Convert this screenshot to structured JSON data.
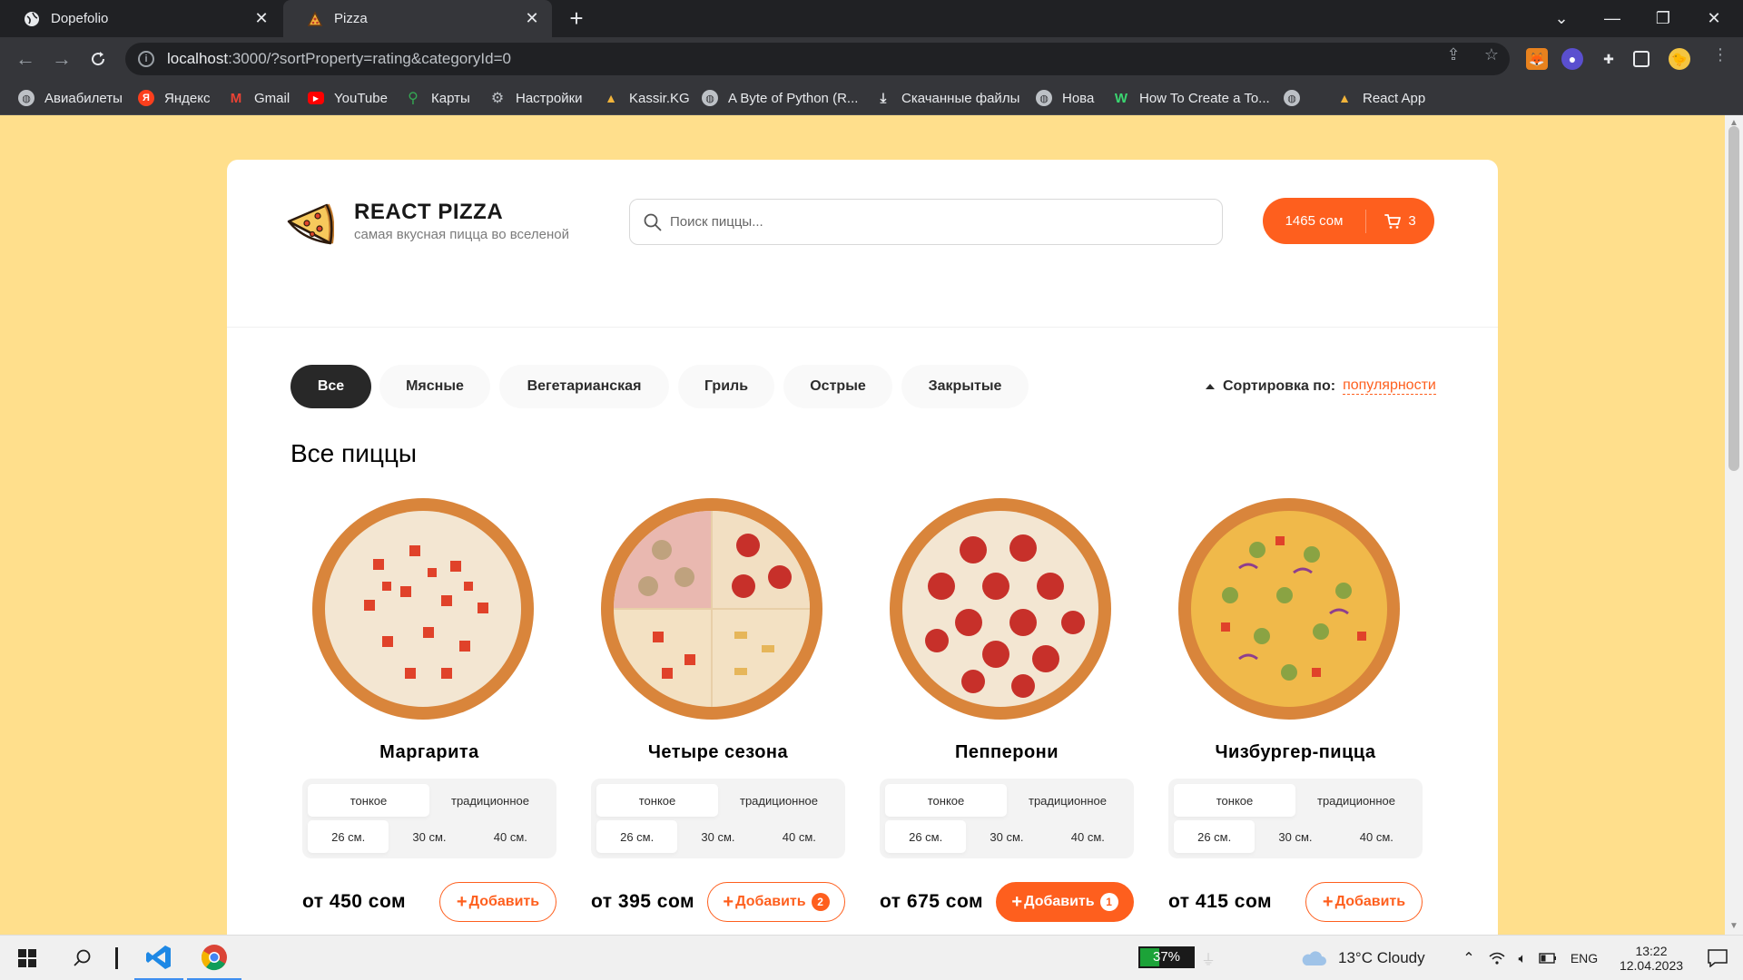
{
  "browser": {
    "tabs": [
      {
        "title": "Dopefolio",
        "active": false
      },
      {
        "title": "Pizza",
        "active": true
      }
    ],
    "url_host": "localhost",
    "url_rest": ":3000/?sortProperty=rating&categoryId=0",
    "bookmarks": [
      {
        "label": "Авиабилеты",
        "icon": "globe-icon"
      },
      {
        "label": "Яндекс",
        "icon": "yandex-icon"
      },
      {
        "label": "Gmail",
        "icon": "gmail-icon"
      },
      {
        "label": "YouTube",
        "icon": "youtube-icon"
      },
      {
        "label": "Карты",
        "icon": "maps-icon"
      },
      {
        "label": "Настройки",
        "icon": "gear-icon"
      },
      {
        "label": "Kassir.KG",
        "icon": "pizza-icon"
      },
      {
        "label": "A Byte of Python (R...",
        "icon": "globe-icon"
      },
      {
        "label": "Скачанные файлы",
        "icon": "download-icon"
      },
      {
        "label": "Нова",
        "icon": "globe-icon"
      },
      {
        "label": "How To Create a To...",
        "icon": "w-icon"
      },
      {
        "label": "",
        "icon": "globe-icon"
      },
      {
        "label": "React App",
        "icon": "pizza-icon"
      }
    ]
  },
  "header": {
    "title": "REACT PIZZA",
    "subtitle": "самая вкусная пицца во вселеной",
    "search_placeholder": "Поиск пиццы...",
    "cart_price": "1465 сом",
    "cart_count": "3"
  },
  "categories": [
    {
      "label": "Все",
      "active": true
    },
    {
      "label": "Мясные",
      "active": false
    },
    {
      "label": "Вегетарианская",
      "active": false
    },
    {
      "label": "Гриль",
      "active": false
    },
    {
      "label": "Острые",
      "active": false
    },
    {
      "label": "Закрытые",
      "active": false
    }
  ],
  "sort": {
    "label": "Сортировка по:",
    "value": "популярности"
  },
  "content_title": "Все пиццы",
  "pizzas": [
    {
      "title": "Маргарита",
      "types": [
        "тонкое",
        "традиционное"
      ],
      "sizes": [
        "26 см.",
        "30 см.",
        "40 см."
      ],
      "price": "от 450 сом",
      "add_label": "Добавить",
      "count": ""
    },
    {
      "title": "Четыре сезона",
      "types": [
        "тонкое",
        "традиционное"
      ],
      "sizes": [
        "26 см.",
        "30 см.",
        "40 см."
      ],
      "price": "от 395 сом",
      "add_label": "Добавить",
      "count": "2"
    },
    {
      "title": "Пепперони",
      "types": [
        "тонкое",
        "традиционное"
      ],
      "sizes": [
        "26 см.",
        "30 см.",
        "40 см."
      ],
      "price": "от 675 сом",
      "add_label": "Добавить",
      "count": "1"
    },
    {
      "title": "Чизбургер-пицца",
      "types": [
        "тонкое",
        "традиционное"
      ],
      "sizes": [
        "26 см.",
        "30 см.",
        "40 см."
      ],
      "price": "от 415 сом",
      "add_label": "Добавить",
      "count": ""
    }
  ],
  "taskbar": {
    "battery": "37%",
    "battery_level": 0.37,
    "weather": "13°C  Cloudy",
    "lang": "ENG",
    "time": "13:22",
    "date": "12.04.2023"
  },
  "colors": {
    "accent": "#fe5f1e",
    "page_bg": "#ffdf8c",
    "dark": "#282828"
  }
}
